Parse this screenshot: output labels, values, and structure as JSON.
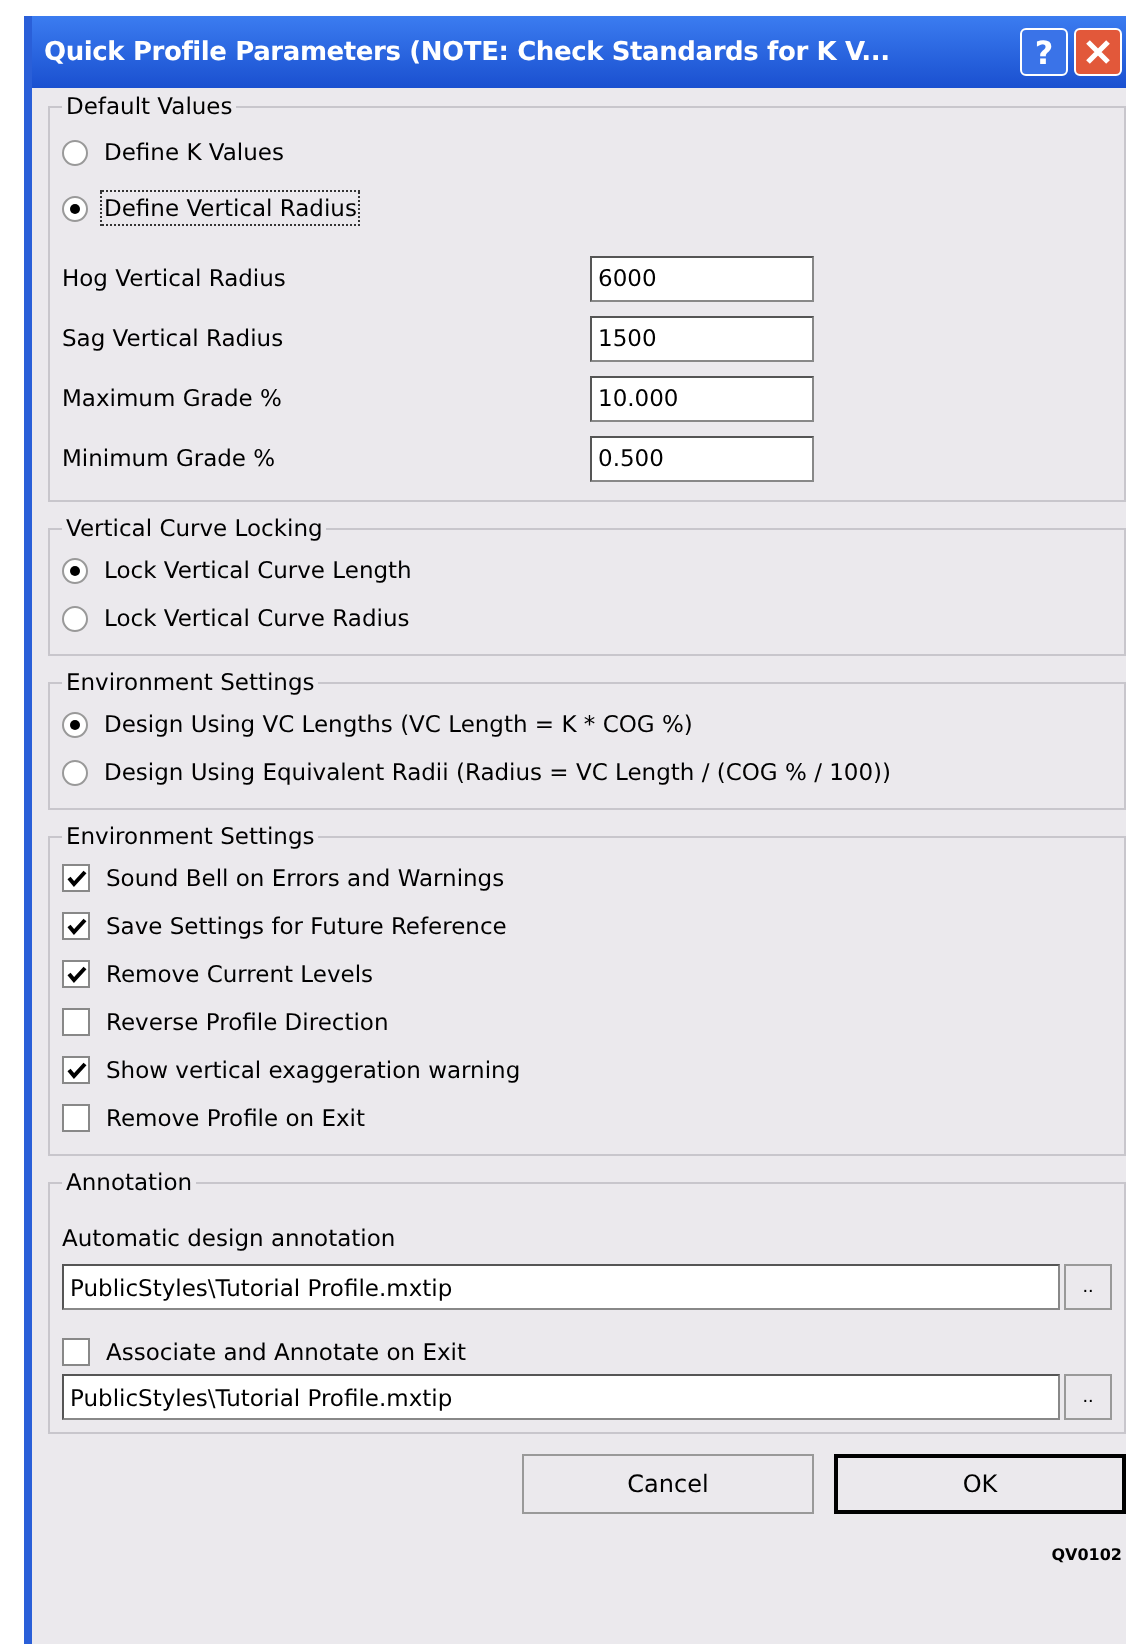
{
  "window": {
    "title": "Quick Profile Parameters (NOTE: Check Standards for K V...",
    "help_button": "?"
  },
  "default_values": {
    "label": "Default Values",
    "options": [
      {
        "label": "Define K Values",
        "selected": false,
        "focused": false
      },
      {
        "label": "Define Vertical Radius",
        "selected": true,
        "focused": true
      }
    ],
    "fields": [
      {
        "label": "Hog Vertical Radius",
        "value": "6000"
      },
      {
        "label": "Sag Vertical Radius",
        "value": "1500"
      },
      {
        "label": "Maximum Grade %",
        "value": "10.000"
      },
      {
        "label": "Minimum Grade %",
        "value": "0.500"
      }
    ]
  },
  "curve_locking": {
    "label": "Vertical Curve Locking",
    "options": [
      {
        "label": "Lock Vertical Curve Length",
        "selected": true
      },
      {
        "label": "Lock Vertical Curve Radius",
        "selected": false
      }
    ]
  },
  "environment_design": {
    "label": "Environment Settings",
    "options": [
      {
        "label": "Design Using VC Lengths (VC Length = K * COG %)",
        "selected": true
      },
      {
        "label": "Design Using Equivalent Radii (Radius = VC Length / (COG % / 100))",
        "selected": false
      }
    ]
  },
  "environment_options": {
    "label": "Environment Settings",
    "checkboxes": [
      {
        "label": "Sound Bell on Errors and Warnings",
        "checked": true
      },
      {
        "label": "Save Settings for Future Reference",
        "checked": true
      },
      {
        "label": "Remove Current Levels",
        "checked": true
      },
      {
        "label": "Reverse Profile Direction",
        "checked": false
      },
      {
        "label": "Show vertical exaggeration warning",
        "checked": true
      },
      {
        "label": "Remove Profile on Exit",
        "checked": false
      }
    ]
  },
  "annotation": {
    "label": "Annotation",
    "design_label": "Automatic design annotation",
    "design_value": "PublicStyles\\Tutorial Profile.mxtip",
    "design_browse": "..",
    "associate": {
      "label": "Associate and Annotate on Exit",
      "checked": false
    },
    "associate_value": "PublicStyles\\Tutorial Profile.mxtip",
    "associate_browse": ".."
  },
  "buttons": [
    {
      "label": "Cancel",
      "default": false
    },
    {
      "label": "OK",
      "default": true
    }
  ],
  "figure_code": "QV0102"
}
